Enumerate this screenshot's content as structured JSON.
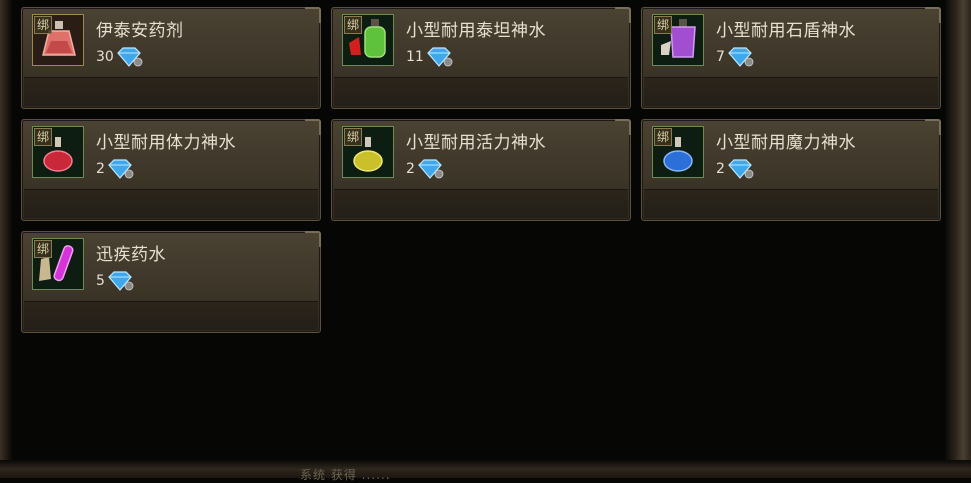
{
  "bind_label": "绑",
  "items": [
    {
      "name": "伊泰安药剂",
      "price": "30",
      "icon": "etain-potion-icon",
      "color": "#e0706a",
      "frame": "gold"
    },
    {
      "name": "小型耐用泰坦神水",
      "price": "11",
      "icon": "titan-potion-icon",
      "color": "#5fc23c",
      "frame": "green"
    },
    {
      "name": "小型耐用石盾神水",
      "price": "7",
      "icon": "stoneshield-potion-icon",
      "color": "#a14fd0",
      "frame": "green"
    },
    {
      "name": "小型耐用体力神水",
      "price": "2",
      "icon": "stamina-potion-icon",
      "color": "#c8283a",
      "frame": "green"
    },
    {
      "name": "小型耐用活力神水",
      "price": "2",
      "icon": "vitality-potion-icon",
      "color": "#c9c02a",
      "frame": "green"
    },
    {
      "name": "小型耐用魔力神水",
      "price": "2",
      "icon": "mana-potion-icon",
      "color": "#2d6fd8",
      "frame": "green"
    },
    {
      "name": "迅疾药水",
      "price": "5",
      "icon": "swiftness-potion-icon",
      "color": "#d535d8",
      "frame": "green"
    }
  ],
  "currency_icon": "diamond-icon",
  "chat_hint": "系统  获得  ......"
}
